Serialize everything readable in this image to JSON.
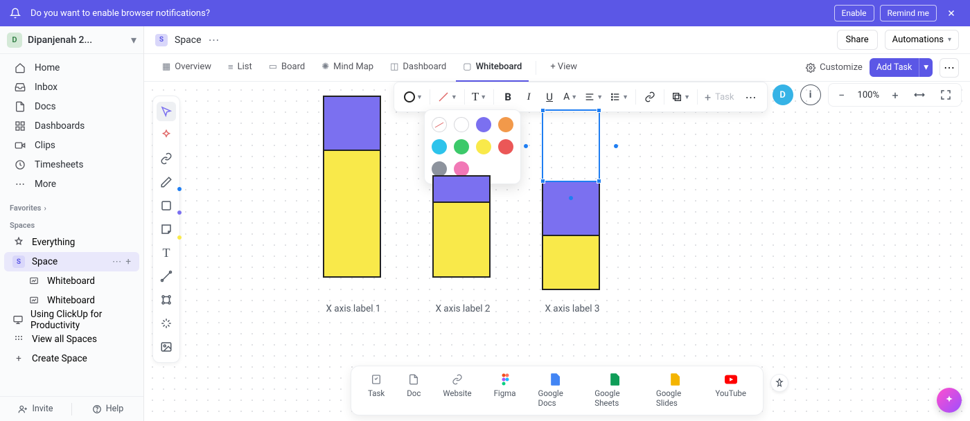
{
  "notification": {
    "text": "Do you want to enable browser notifications?",
    "enable": "Enable",
    "remind": "Remind me"
  },
  "workspace": {
    "initial": "D",
    "name": "Dipanjenah 2..."
  },
  "sidebar": {
    "items": [
      "Home",
      "Inbox",
      "Docs",
      "Dashboards",
      "Clips",
      "Timesheets",
      "More"
    ],
    "favorites_label": "Favorites",
    "spaces_label": "Spaces",
    "everything": "Everything",
    "space": "Space",
    "whiteboard1": "Whiteboard",
    "whiteboard2": "Whiteboard",
    "using": "Using ClickUp for Productivity",
    "view_all": "View all Spaces",
    "create": "Create Space",
    "invite": "Invite",
    "help": "Help"
  },
  "breadcrumb": {
    "space_initial": "S",
    "space": "Space"
  },
  "header": {
    "share": "Share",
    "automations": "Automations",
    "customize": "Customize",
    "add_task": "Add Task"
  },
  "tabs": [
    "Overview",
    "List",
    "Board",
    "Mind Map",
    "Dashboard",
    "Whiteboard",
    "+ View"
  ],
  "toolbar": {
    "task_placeholder": "Task"
  },
  "colors": {
    "none": "none",
    "white": "#ffffff",
    "purple": "#7b70f0",
    "orange": "#f2994a",
    "cyan": "#2dc3eb",
    "green": "#3cc96a",
    "yellow": "#f9e94a",
    "red": "#eb5757",
    "gray": "#8d939d",
    "pink": "#f178b6"
  },
  "zoom": {
    "value": "100%"
  },
  "avatar": "D",
  "chart_data": {
    "type": "bar",
    "categories": [
      "X axis label 1",
      "X axis label 2",
      "X axis label 3"
    ],
    "series": [
      {
        "name": "purple",
        "color": "#7b70f0",
        "values": [
          80,
          40,
          80
        ]
      },
      {
        "name": "yellow",
        "color": "#f9e94a",
        "values": [
          185,
          110,
          80
        ]
      }
    ]
  },
  "dock": [
    "Task",
    "Doc",
    "Website",
    "Figma",
    "Google Docs",
    "Google Sheets",
    "Google Slides",
    "YouTube"
  ]
}
